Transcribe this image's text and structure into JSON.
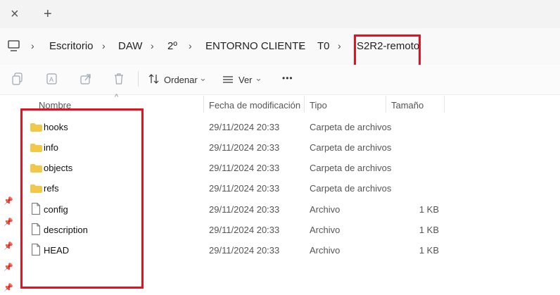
{
  "tabs": {
    "close_glyph": "×",
    "new_glyph": "+"
  },
  "breadcrumb": {
    "separator": "›",
    "items": [
      "Escritorio",
      "DAW",
      "2º",
      "ENTORNO CLIENTE",
      "T0",
      "S2R2-remoto"
    ]
  },
  "toolbar": {
    "sort_label": "Ordenar",
    "view_label": "Ver",
    "more_label": "•••",
    "chevron": "⌄"
  },
  "columns": {
    "name": "Nombre",
    "date": "Fecha de modificación",
    "type": "Tipo",
    "size": "Tamaño",
    "sort_glyph": "^"
  },
  "files": [
    {
      "name": "hooks",
      "kind": "folder",
      "date": "29/11/2024 20:33",
      "type": "Carpeta de archivos",
      "size": ""
    },
    {
      "name": "info",
      "kind": "folder",
      "date": "29/11/2024 20:33",
      "type": "Carpeta de archivos",
      "size": ""
    },
    {
      "name": "objects",
      "kind": "folder",
      "date": "29/11/2024 20:33",
      "type": "Carpeta de archivos",
      "size": ""
    },
    {
      "name": "refs",
      "kind": "folder",
      "date": "29/11/2024 20:33",
      "type": "Carpeta de archivos",
      "size": ""
    },
    {
      "name": "config",
      "kind": "file",
      "date": "29/11/2024 20:33",
      "type": "Archivo",
      "size": "1 KB"
    },
    {
      "name": "description",
      "kind": "file",
      "date": "29/11/2024 20:33",
      "type": "Archivo",
      "size": "1 KB"
    },
    {
      "name": "HEAD",
      "kind": "file",
      "date": "29/11/2024 20:33",
      "type": "Archivo",
      "size": "1 KB"
    }
  ],
  "sidebar": {
    "pin_glyph": "📌"
  },
  "colors": {
    "folder": "#f2c84b",
    "highlight": "#e8101a",
    "accent": "#0067c0"
  }
}
